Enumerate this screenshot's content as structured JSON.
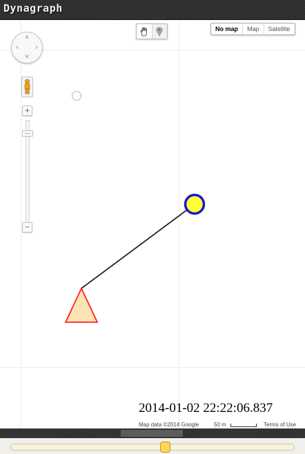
{
  "app": {
    "title": "Dynagraph"
  },
  "map": {
    "type_buttons": [
      "No map",
      "Map",
      "Satellite"
    ],
    "selected_type": "No map",
    "tools": [
      "hand-icon",
      "marker-icon"
    ],
    "pan_icons": [
      "chevron-up-icon",
      "chevron-down-icon",
      "chevron-left-icon",
      "chevron-right-icon"
    ],
    "zoom_in_label": "+",
    "zoom_out_label": "−",
    "zoom_level_fraction": 0.9
  },
  "timestamp": "2014-01-02 22:22:06.837",
  "footer": {
    "map_data": "Map data ©2014 Google",
    "scale": "50 m",
    "terms": "Terms of Use"
  },
  "timeline": {
    "position_fraction": 0.55
  },
  "colors": {
    "circle_fill": "#ffff33",
    "circle_stroke": "#1a1acc",
    "triangle_fill": "#fde2b6",
    "triangle_stroke": "#ff2222",
    "line": "#222222",
    "slider_thumb": "#ffd85a"
  }
}
